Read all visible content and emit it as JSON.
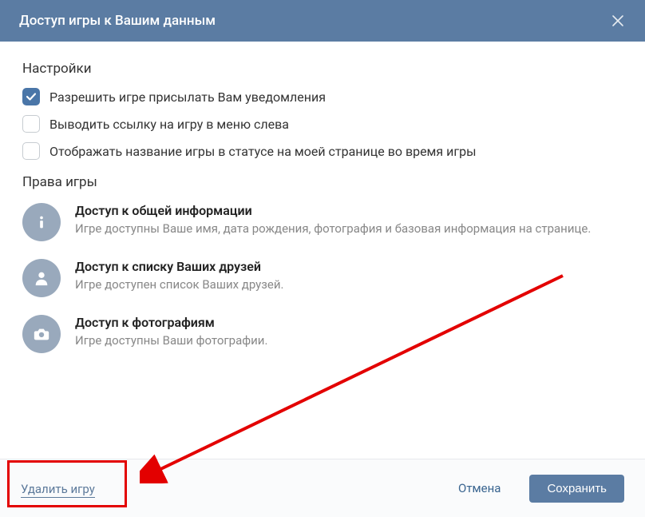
{
  "header": {
    "title": "Доступ игры к Вашим данным"
  },
  "settings": {
    "heading": "Настройки",
    "items": [
      {
        "label": "Разрешить игре присылать Вам уведомления",
        "checked": true
      },
      {
        "label": "Выводить ссылку на игру в меню слева",
        "checked": false
      },
      {
        "label": "Отображать название игры в статусе на моей странице во время игры",
        "checked": false
      }
    ]
  },
  "permissions": {
    "heading": "Права игры",
    "items": [
      {
        "icon": "info",
        "title": "Доступ к общей информации",
        "desc": "Игре доступны Ваше имя, дата рождения, фотография и базовая информация на странице."
      },
      {
        "icon": "user",
        "title": "Доступ к списку Ваших друзей",
        "desc": "Игре доступен список Ваших друзей."
      },
      {
        "icon": "camera",
        "title": "Доступ к фотографиям",
        "desc": "Игре доступны Ваши фотографии."
      }
    ]
  },
  "footer": {
    "delete": "Удалить игру",
    "cancel": "Отмена",
    "save": "Сохранить"
  }
}
